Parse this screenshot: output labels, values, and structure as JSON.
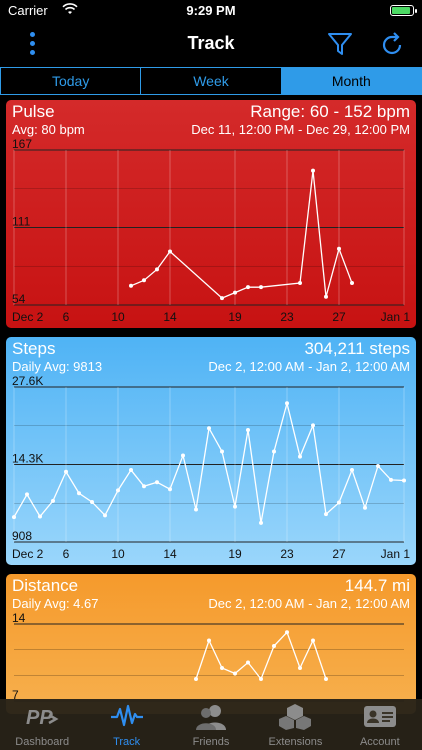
{
  "status_bar": {
    "carrier": "Carrier",
    "time": "9:29 PM",
    "battery_level": 0.9,
    "battery_color": "#4cd964"
  },
  "nav": {
    "title": "Track",
    "menu_icon": "vertical-dots-icon",
    "filter_icon": "funnel-icon",
    "refresh_icon": "refresh-icon",
    "accent": "#2f8ef0"
  },
  "segments": [
    {
      "label": "Today",
      "selected": false
    },
    {
      "label": "Week",
      "selected": false
    },
    {
      "label": "Month",
      "selected": true
    }
  ],
  "cards": {
    "pulse": {
      "title": "Pulse",
      "range": "Range: 60 - 152 bpm",
      "avg": "Avg: 80 bpm",
      "period": "Dec 11, 12:00 PM - Dec 29, 12:00 PM",
      "color": "#d42a2a"
    },
    "steps": {
      "title": "Steps",
      "total": "304,211 steps",
      "avg": "Daily Avg: 9813",
      "period": "Dec 2, 12:00 AM - Jan 2, 12:00 AM",
      "color": "#4fb3f5"
    },
    "distance": {
      "title": "Distance",
      "total": "144.7 mi",
      "avg": "Daily Avg: 4.67",
      "period": "Dec 2, 12:00 AM - Jan 2, 12:00 AM",
      "color": "#f59a2c"
    }
  },
  "chart_data": [
    {
      "id": "pulse",
      "type": "line",
      "xlabel": "",
      "ylabel": "",
      "x_ticks": [
        "Dec 2",
        "6",
        "10",
        "14",
        "19",
        "23",
        "27",
        "Jan 1"
      ],
      "x_tick_days": [
        2,
        6,
        10,
        14,
        19,
        23,
        27,
        32
      ],
      "y_ticks": [
        "167",
        "111",
        "54"
      ],
      "ylim": [
        54,
        167
      ],
      "xlim": [
        2,
        32
      ],
      "series": [
        {
          "x": [
            11,
            12,
            13,
            14,
            18,
            19,
            20,
            21,
            24,
            25,
            26,
            27,
            28
          ],
          "values": [
            68,
            72,
            80,
            93,
            59,
            63,
            67,
            67,
            70,
            152,
            60,
            95,
            70
          ]
        }
      ]
    },
    {
      "id": "steps",
      "type": "line",
      "xlabel": "",
      "ylabel": "",
      "x_ticks": [
        "Dec 2",
        "6",
        "10",
        "14",
        "19",
        "23",
        "27",
        "Jan 1"
      ],
      "x_tick_days": [
        2,
        6,
        10,
        14,
        19,
        23,
        27,
        32
      ],
      "y_ticks": [
        "27.6K",
        "14.3K",
        "908"
      ],
      "ylim": [
        908,
        27600
      ],
      "xlim": [
        2,
        32
      ],
      "series": [
        {
          "x": [
            2,
            3,
            4,
            5,
            6,
            7,
            8,
            9,
            10,
            11,
            12,
            13,
            14,
            15,
            16,
            17,
            18,
            19,
            20,
            21,
            22,
            23,
            24,
            25,
            26,
            27,
            28,
            29,
            30,
            31,
            32
          ],
          "values": [
            5200,
            9100,
            5300,
            8000,
            13000,
            9300,
            7800,
            5500,
            9800,
            13300,
            10500,
            11200,
            10000,
            15800,
            6500,
            20500,
            16500,
            7000,
            20200,
            4200,
            16500,
            24800,
            15600,
            21000,
            5700,
            7700,
            13300,
            6800,
            14000,
            11600,
            11500
          ]
        }
      ]
    },
    {
      "id": "distance",
      "type": "line",
      "xlabel": "",
      "ylabel": "",
      "x_ticks": [],
      "y_ticks": [
        "14",
        "7"
      ],
      "ylim": [
        0,
        14
      ],
      "xlim": [
        2,
        32
      ],
      "series": [
        {
          "x": [
            16,
            17,
            18,
            19,
            20,
            21,
            22,
            23,
            24,
            25,
            26
          ],
          "values": [
            4,
            11,
            6,
            5,
            7,
            4,
            10,
            12.5,
            6,
            11,
            4
          ]
        }
      ]
    }
  ],
  "tabbar": [
    {
      "label": "Dashboard",
      "icon": "pp-logo-icon",
      "active": false
    },
    {
      "label": "Track",
      "icon": "pulse-wave-icon",
      "active": true
    },
    {
      "label": "Friends",
      "icon": "people-icon",
      "active": false
    },
    {
      "label": "Extensions",
      "icon": "cubes-icon",
      "active": false
    },
    {
      "label": "Account",
      "icon": "id-card-icon",
      "active": false
    }
  ]
}
